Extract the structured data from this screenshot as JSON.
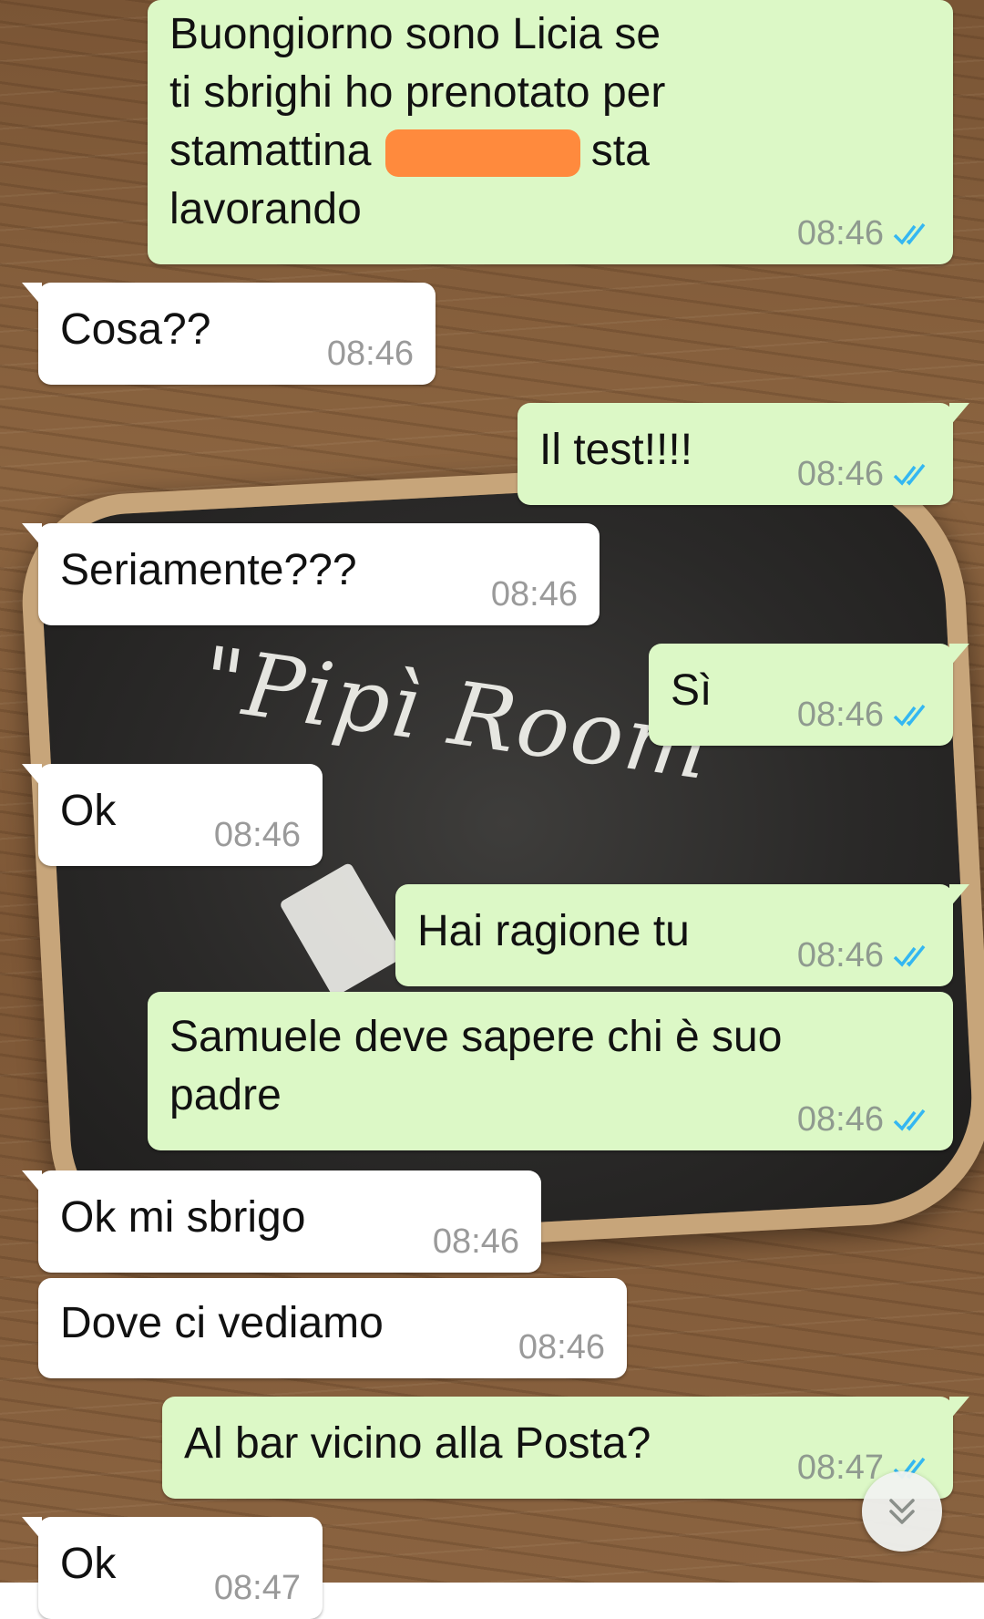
{
  "messages": [
    {
      "id": "m1",
      "dir": "out",
      "text_before": "Buongiorno sono Licia se\nti sbrighi ho prenotato per\nstamattina",
      "text_after": "sta\nlavorando",
      "time": "08:46",
      "status": "read"
    },
    {
      "id": "m2",
      "dir": "in",
      "text": "Cosa??",
      "time": "08:46"
    },
    {
      "id": "m3",
      "dir": "out",
      "text": "Il test!!!!",
      "time": "08:46",
      "status": "read"
    },
    {
      "id": "m4",
      "dir": "in",
      "text": "Seriamente???",
      "time": "08:46"
    },
    {
      "id": "m5",
      "dir": "out",
      "text": "Sì",
      "time": "08:46",
      "status": "read"
    },
    {
      "id": "m6",
      "dir": "in",
      "text": "Ok",
      "time": "08:46"
    },
    {
      "id": "m7",
      "dir": "out",
      "text": "Hai ragione tu",
      "time": "08:46",
      "status": "read"
    },
    {
      "id": "m8",
      "dir": "out",
      "text": "Samuele deve sapere chi è suo\npadre",
      "time": "08:46",
      "status": "read"
    },
    {
      "id": "m9",
      "dir": "in",
      "text": "Ok mi sbrigo",
      "time": "08:46"
    },
    {
      "id": "m10",
      "dir": "in",
      "text": "Dove ci vediamo",
      "time": "08:46"
    },
    {
      "id": "m11",
      "dir": "out",
      "text": "Al bar vicino alla Posta?",
      "time": "08:47",
      "status": "read"
    },
    {
      "id": "m12",
      "dir": "in",
      "text": "Ok",
      "time": "08:47"
    }
  ],
  "wallpaper": {
    "board_text": "\"Pipì Room\""
  },
  "icons": {
    "read_receipt": "double-check-icon",
    "scroll": "chevron-double-down-icon"
  },
  "colors": {
    "outgoing_bubble": "#dcf8c6",
    "incoming_bubble": "#ffffff",
    "read_check": "#34b7f1",
    "redaction": "#ff8a3d"
  }
}
